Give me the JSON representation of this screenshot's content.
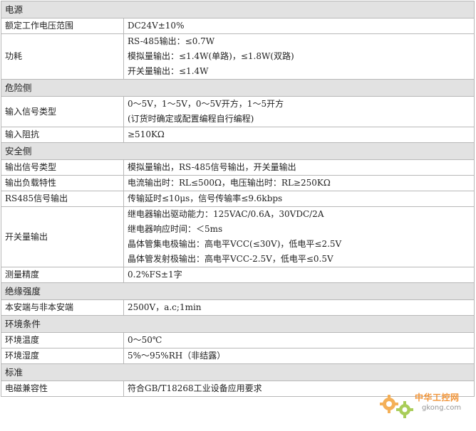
{
  "sections": [
    {
      "title": "电源",
      "rows": [
        {
          "label": "额定工作电压范围",
          "lines": [
            "DC24V±10%"
          ]
        },
        {
          "label": "功耗",
          "lines": [
            "RS-485输出：≤0.7W",
            "模拟量输出：≤1.4W(单路)，≤1.8W(双路)",
            "开关量输出：≤1.4W"
          ]
        }
      ]
    },
    {
      "title": "危险侧",
      "rows": [
        {
          "label": "输入信号类型",
          "lines": [
            "0～5V，1～5V，0～5V开方，1～5开方",
            "(订货时确定或配置编程自行编程)"
          ]
        },
        {
          "label": "输入阻抗",
          "lines": [
            "≥510KΩ"
          ]
        }
      ]
    },
    {
      "title": "安全侧",
      "rows": [
        {
          "label": "输出信号类型",
          "lines": [
            "模拟量输出，RS-485信号输出，开关量输出"
          ]
        },
        {
          "label": "输出负载特性",
          "lines": [
            "电流输出时：RL≤500Ω，电压输出时：RL≥250KΩ"
          ]
        },
        {
          "label": "RS485信号输出",
          "lines": [
            "传输延时≤10μs，信号传输率≤9.6kbps"
          ]
        },
        {
          "label": "开关量输出",
          "lines": [
            "继电器输出驱动能力：125VAC/0.6A，30VDC/2A",
            "继电器响应时间：＜5ms",
            "晶体管集电极输出：高电平VCC(≤30V)，低电平≤2.5V",
            "晶体管发射极输出：高电平VCC-2.5V，低电平≤0.5V"
          ]
        },
        {
          "label": "测量精度",
          "lines": [
            "0.2%FS±1字"
          ]
        }
      ]
    },
    {
      "title": "绝缘强度",
      "rows": [
        {
          "label": "本安端与非本安端",
          "lines": [
            "2500V，a.c;1min"
          ]
        }
      ]
    },
    {
      "title": "环境条件",
      "rows": [
        {
          "label": "环境温度",
          "lines": [
            "0～50℃"
          ]
        },
        {
          "label": "环境湿度",
          "lines": [
            "5%～95%RH（非结露）"
          ]
        }
      ]
    },
    {
      "title": "标准",
      "rows": [
        {
          "label": "电磁兼容性",
          "lines": [
            "符合GB/T18268工业设备应用要求"
          ]
        }
      ]
    }
  ],
  "watermark": {
    "brand": "中华工控网",
    "site": "gkong.com",
    "color": "#f08a24"
  }
}
